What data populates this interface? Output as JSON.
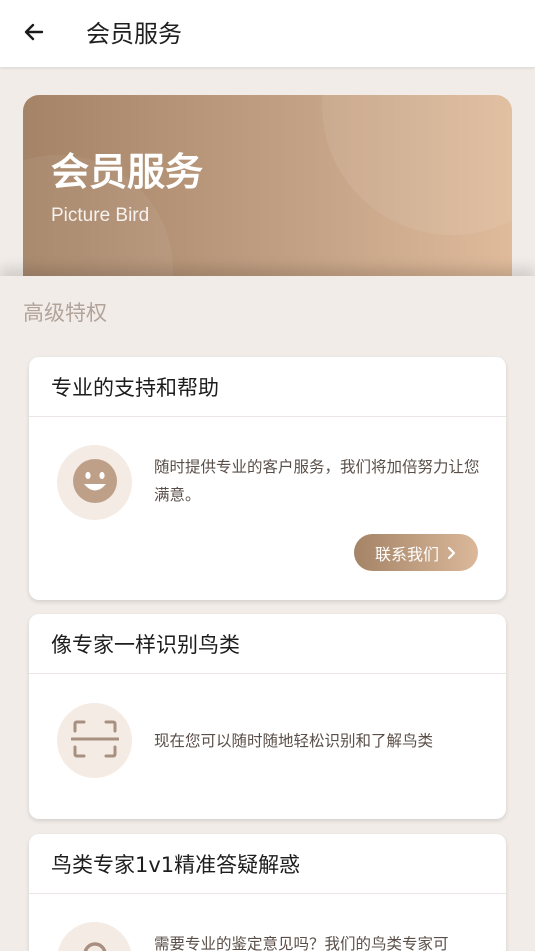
{
  "appbar": {
    "title": "会员服务",
    "back_icon": "arrow-left-icon"
  },
  "hero": {
    "title": "会员服务",
    "subtitle": "Picture Bird",
    "gradient": [
      "#a48366",
      "#dfbb9b"
    ]
  },
  "section": {
    "title": "高级特权"
  },
  "cards": [
    {
      "title": "专业的支持和帮助",
      "icon": "smile-icon",
      "description": "随时提供专业的客户服务，我们将加倍努力让您满意。",
      "button_label": "联系我们",
      "button_icon": "chevron-right-icon"
    },
    {
      "title": "像专家一样识别鸟类",
      "icon": "scan-icon",
      "description": "现在您可以随时随地轻松识别和了解鸟类"
    },
    {
      "title": "鸟类专家1v1精准答疑解惑",
      "icon": "expert-icon",
      "description": "需要专业的鉴定意见吗？我们的鸟类专家可"
    }
  ],
  "colors": {
    "accent": "#a48366",
    "accent_light": "#dbb89a",
    "background": "#f1ece8",
    "icon_circle": "#f5ebe5"
  }
}
